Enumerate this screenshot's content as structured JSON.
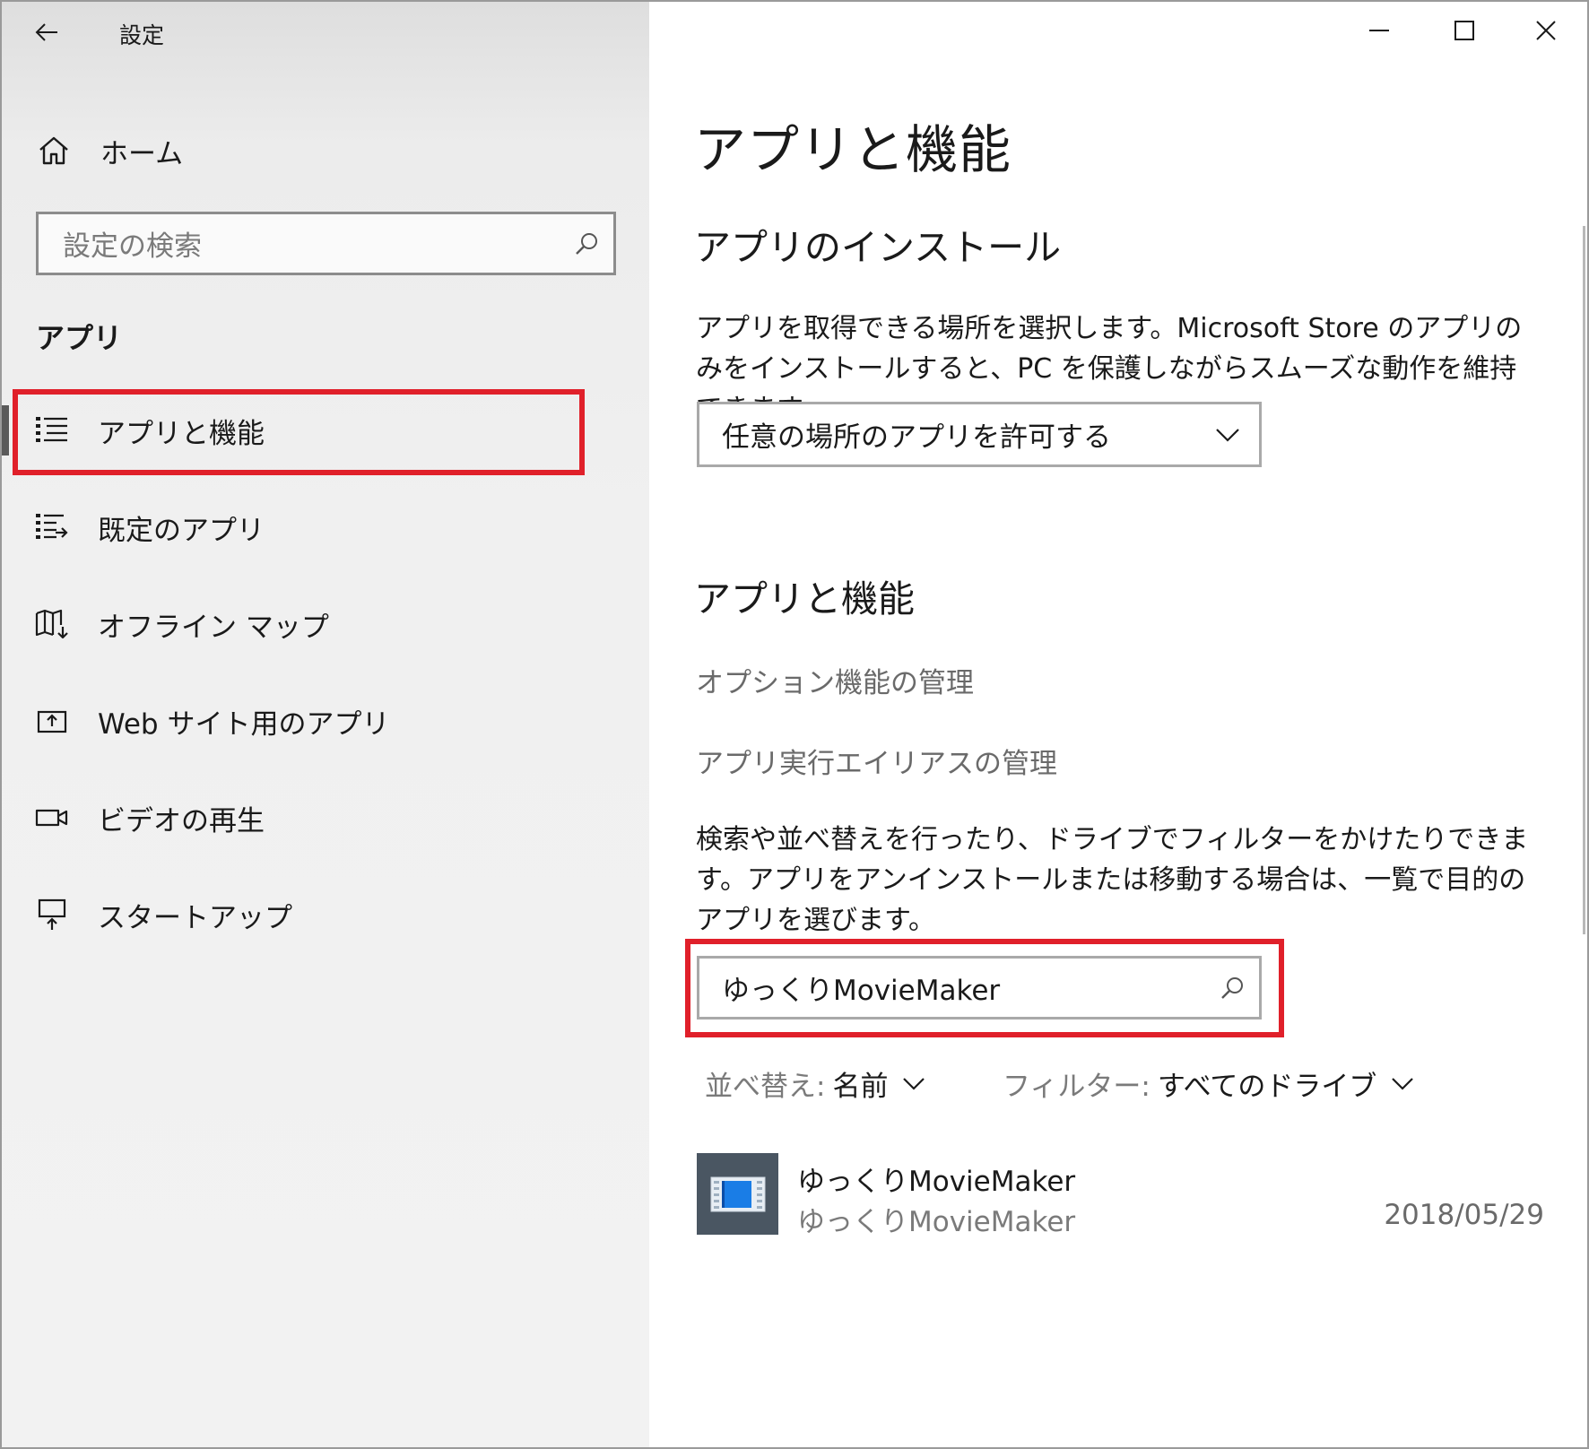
{
  "window": {
    "title": "設定",
    "controls": {
      "minimize": "minimize",
      "maximize": "maximize",
      "close": "close"
    }
  },
  "sidebar": {
    "home_label": "ホーム",
    "search_placeholder": "設定の検索",
    "section_heading": "アプリ",
    "items": [
      {
        "label": "アプリと機能",
        "icon": "apps-features-icon",
        "active": true
      },
      {
        "label": "既定のアプリ",
        "icon": "default-apps-icon",
        "active": false
      },
      {
        "label": "オフライン マップ",
        "icon": "offline-maps-icon",
        "active": false
      },
      {
        "label": "Web サイト用のアプリ",
        "icon": "apps-for-websites-icon",
        "active": false
      },
      {
        "label": "ビデオの再生",
        "icon": "video-playback-icon",
        "active": false
      },
      {
        "label": "スタートアップ",
        "icon": "startup-icon",
        "active": false
      }
    ]
  },
  "main": {
    "page_title": "アプリと機能",
    "install_heading": "アプリのインストール",
    "install_desc": "アプリを取得できる場所を選択します。Microsoft Store のアプリのみをインストールすると、PC を保護しながらスムーズな動作を維持できます。",
    "install_dropdown_value": "任意の場所のアプリを許可する",
    "features_heading": "アプリと機能",
    "link_optional_features": "オプション機能の管理",
    "link_alias": "アプリ実行エイリアスの管理",
    "features_desc": "検索や並べ替えを行ったり、ドライブでフィルターをかけたりできます。アプリをアンインストールまたは移動する場合は、一覧で目的のアプリを選びます。",
    "app_search_value": "ゆっくりMovieMaker",
    "sort_label": "並べ替え:",
    "sort_value": "名前",
    "filter_label": "フィルター:",
    "filter_value": "すべてのドライブ",
    "apps": [
      {
        "name": "ゆっくりMovieMaker",
        "publisher": "ゆっくりMovieMaker",
        "date": "2018/05/29"
      }
    ]
  },
  "colors": {
    "highlight": "#e0202a",
    "sidebar_bg": "#f0f0f0",
    "link": "#6a6a6a"
  }
}
